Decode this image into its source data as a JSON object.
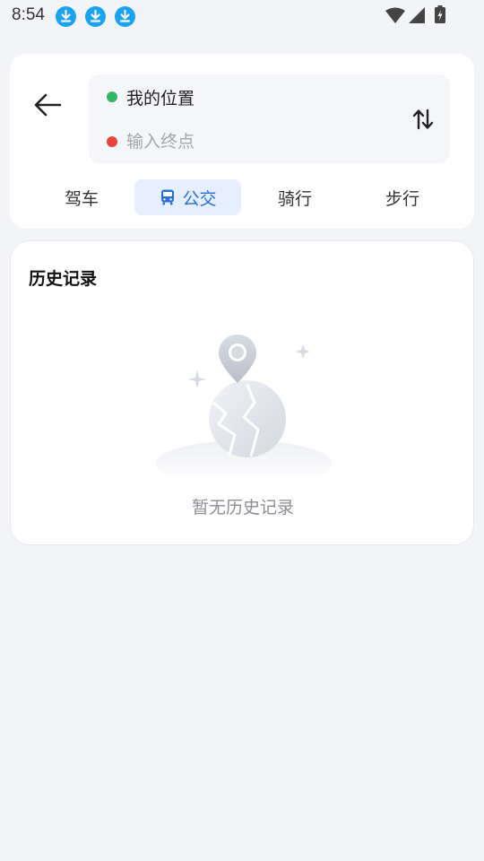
{
  "status_bar": {
    "time": "8:54",
    "notification_icons": [
      "download-icon",
      "download-icon",
      "download-icon"
    ],
    "system_icons": [
      "wifi-icon",
      "signal-icon",
      "battery-charging-icon"
    ]
  },
  "route": {
    "start_label": "我的位置",
    "start_dot_color": "#34b765",
    "end_value": "",
    "end_placeholder": "输入终点",
    "end_dot_color": "#e8443a",
    "swap_icon": "swap-vertical-icon",
    "back_icon": "arrow-left-icon"
  },
  "modes": {
    "active": "公交",
    "items": [
      {
        "label": "驾车",
        "icon": ""
      },
      {
        "label": "公交",
        "icon": "bus-icon"
      },
      {
        "label": "骑行",
        "icon": ""
      },
      {
        "label": "步行",
        "icon": ""
      }
    ]
  },
  "history": {
    "title": "历史记录",
    "empty_text": "暂无历史记录",
    "empty_icon": "empty-location-globe-icon"
  },
  "colors": {
    "accent": "#2a6fd6",
    "active_tab_bg": "#e5efff",
    "page_bg": "#f3f4f7"
  }
}
